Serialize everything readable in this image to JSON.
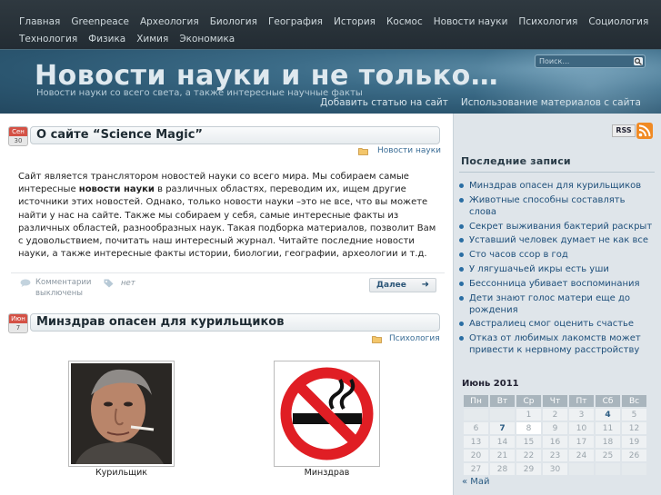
{
  "nav": {
    "row1": [
      "Главная",
      "Greenpeace",
      "Археология",
      "Биология",
      "География",
      "История",
      "Космос",
      "Новости науки",
      "Психология",
      "Социология"
    ],
    "row2": [
      "Технология",
      "Физика",
      "Химия",
      "Экономика"
    ]
  },
  "header": {
    "title": "Новости науки и не только…",
    "tagline": "Новости науки со всего света, а также интересные научные факты",
    "links": [
      "Добавить статью на сайт",
      "Использование материалов с сайта"
    ],
    "search_placeholder": "Поиск…"
  },
  "posts": [
    {
      "month": "Сен",
      "day": "30",
      "title": "О сайте “Science Magic”",
      "category": "Новости науки",
      "body_before": "Сайт является транслятором новостей науки со всего мира. Мы собираем самые интересные ",
      "body_bold": "новости науки",
      "body_after": "  в различных областях, переводим их, ищем другие источники этих новостей. Однако, только новости науки  –это не все, что вы можете найти у нас на сайте. Также мы собираем у себя, самые интересные факты из различных областей, разнообразных наук. Такая подборка материалов, позволит Вам с удовольствием, почитать наш интересный журнал. Читайте последние новости науки, а также интересные факты истории, биологии, географии, археологии и т.д.",
      "comments": "Комментарии выключены",
      "tags": "нет",
      "more": "Далее"
    },
    {
      "month": "Июн",
      "day": "7",
      "title": "Минздрав опасен для курильщиков",
      "category": "Психология",
      "fig1_caption": "Курильщик",
      "fig2_caption": "Минздрав"
    }
  ],
  "sidebar": {
    "rss": "RSS",
    "recent_heading": "Последние записи",
    "recent": [
      "Минздрав опасен для курильщиков",
      "Животные способны составлять слова",
      "Секрет выживания бактерий раскрыт",
      "Уставший человек думает не как все",
      "Сто часов ссор в год",
      "У лягушачьей икры есть уши",
      "Бессонница убивает воспоминания",
      "Дети знают голос матери еще до рождения",
      "Австралиец смог оценить счастье",
      "Отказ от любимых лакомств может привести к нервному расстройству"
    ],
    "calendar": {
      "title": "Июнь 2011",
      "weekdays": [
        "Пн",
        "Вт",
        "Ср",
        "Чт",
        "Пт",
        "Сб",
        "Вс"
      ],
      "weeks": [
        [
          "",
          "",
          "1",
          "2",
          "3",
          "4",
          "5"
        ],
        [
          "6",
          "7",
          "8",
          "9",
          "10",
          "11",
          "12"
        ],
        [
          "13",
          "14",
          "15",
          "16",
          "17",
          "18",
          "19"
        ],
        [
          "20",
          "21",
          "22",
          "23",
          "24",
          "25",
          "26"
        ],
        [
          "27",
          "28",
          "29",
          "30",
          "",
          "",
          ""
        ]
      ],
      "linked_days": [
        "4",
        "7"
      ],
      "highlight_day": "8",
      "prev": "« Май"
    }
  },
  "colors": {
    "nav_bg": "#2a343b",
    "header_bg": "#3c6c88",
    "link": "#1e4f7a",
    "date_red": "#d45145"
  }
}
